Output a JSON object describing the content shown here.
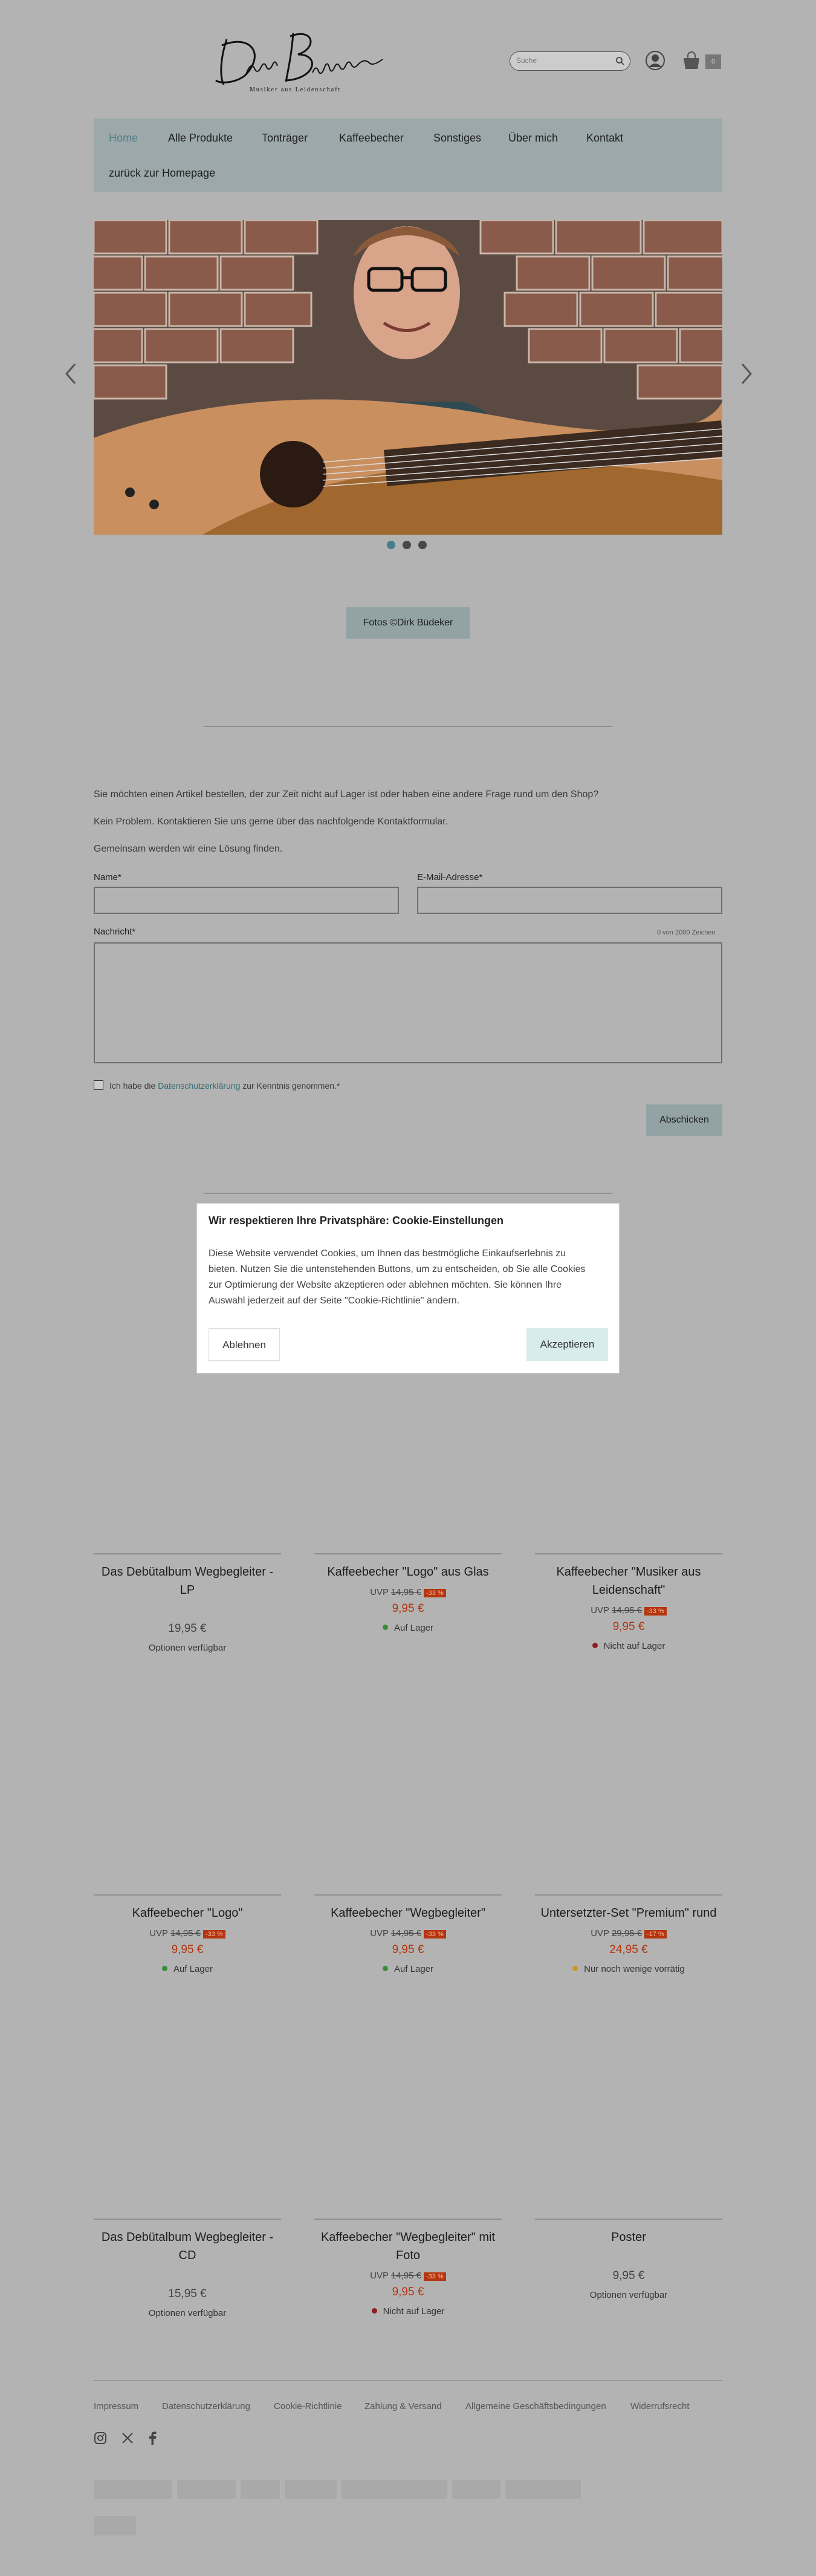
{
  "header": {
    "logo_text": "Dirk Büdeker",
    "logo_tagline": "Musiker aus Leidenschaft",
    "search_placeholder": "Suche",
    "cart_count": "0"
  },
  "nav": {
    "items": [
      "Home",
      "Alle Produkte",
      "Tonträger",
      "Kaffeebecher",
      "Sonstiges",
      "Über mich",
      "Kontakt"
    ],
    "back_link": "zurück zur Homepage"
  },
  "slider": {
    "dots": 3,
    "active": 0
  },
  "photo_credit": "Fotos ©Dirk Büdeker",
  "contact": {
    "intro1": "Sie möchten einen Artikel bestellen, der zur Zeit nicht auf Lager ist oder haben eine andere Frage rund um den Shop?",
    "intro2": "Kein Problem. Kontaktieren Sie uns gerne über das nachfolgende Kontaktformular.",
    "intro3": "Gemeinsam werden wir eine Lösung finden.",
    "name_label": "Name*",
    "email_label": "E-Mail-Adresse*",
    "message_label": "Nachricht*",
    "char_count": "0 von 2000 Zeichen",
    "privacy_before": "Ich habe die",
    "privacy_link": "Datenschutzerklärung",
    "privacy_after": "zur Kenntnis genommen.*",
    "submit": "Abschicken"
  },
  "cookie": {
    "title": "Wir respektieren Ihre Privatsphäre: Cookie-Einstellungen",
    "text": "Diese Website verwendet Cookies, um Ihnen das bestmögliche Einkaufserlebnis zu bieten. Nutzen Sie die untenstehenden Buttons, um zu entscheiden, ob Sie alle Cookies zur Optimierung der Website akzeptieren oder ablehnen möchten. Sie können Ihre Auswahl jederzeit auf der Seite \"Cookie-Richtlinie\" ändern.",
    "decline": "Ablehnen",
    "accept": "Akzeptieren"
  },
  "products": [
    {
      "title": "Das Debütalbum Wegbegleiter - LP",
      "uvp_label": "",
      "uvp": "",
      "badge": "",
      "price": "19,95 €",
      "sale": false,
      "status": "Optionen verfügbar",
      "status_color": ""
    },
    {
      "title": "Kaffeebecher \"Logo\" aus Glas",
      "uvp_label": "UVP",
      "uvp": "14,95 €",
      "badge": "-33 %",
      "price": "9,95 €",
      "sale": true,
      "status": "Auf Lager",
      "status_color": "#3a8c3a"
    },
    {
      "title": "Kaffeebecher \"Musiker aus Leidenschaft\"",
      "uvp_label": "UVP",
      "uvp": "14,95 €",
      "badge": "-33 %",
      "price": "9,95 €",
      "sale": true,
      "status": "Nicht auf Lager",
      "status_color": "#8e1f1f"
    },
    {
      "title": "Kaffeebecher \"Logo\"",
      "uvp_label": "UVP",
      "uvp": "14,95 €",
      "badge": "-33 %",
      "price": "9,95 €",
      "sale": true,
      "status": "Auf Lager",
      "status_color": "#3a8c3a"
    },
    {
      "title": "Kaffeebecher \"Wegbegleiter\"",
      "uvp_label": "UVP",
      "uvp": "14,95 €",
      "badge": "-33 %",
      "price": "9,95 €",
      "sale": true,
      "status": "Auf Lager",
      "status_color": "#3a8c3a"
    },
    {
      "title": "Untersetzter-Set \"Premium\" rund",
      "uvp_label": "UVP",
      "uvp": "29,95 €",
      "badge": "-17 %",
      "price": "24,95 €",
      "sale": true,
      "status": "Nur noch wenige vorrätig",
      "status_color": "#c99a1f"
    },
    {
      "title": "Das Debütalbum Wegbegleiter - CD",
      "uvp_label": "",
      "uvp": "",
      "badge": "",
      "price": "15,95 €",
      "sale": false,
      "status": "Optionen verfügbar",
      "status_color": ""
    },
    {
      "title": "Kaffeebecher \"Wegbegleiter\" mit Foto",
      "uvp_label": "UVP",
      "uvp": "14,95 €",
      "badge": "-33 %",
      "price": "9,95 €",
      "sale": true,
      "status": "Nicht auf Lager",
      "status_color": "#8e1f1f"
    },
    {
      "title": "Poster",
      "uvp_label": "",
      "uvp": "",
      "badge": "",
      "price": "9,95 €",
      "sale": false,
      "status": "Optionen verfügbar",
      "status_color": ""
    }
  ],
  "footer": {
    "links": [
      "Impressum",
      "Datenschutzerklärung",
      "Cookie-Richtlinie",
      "Zahlung & Versand",
      "Allgemeine Geschäftsbedingungen",
      "Widerrufsrecht"
    ],
    "social": [
      "instagram-icon",
      "x-icon",
      "facebook-icon"
    ]
  }
}
